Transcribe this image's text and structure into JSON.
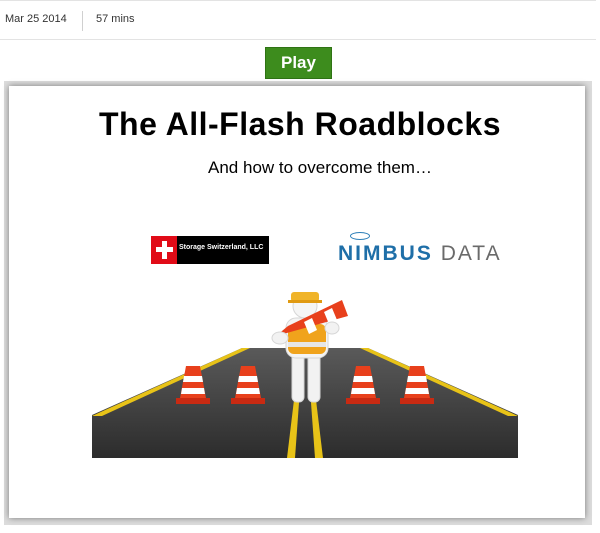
{
  "meta": {
    "date": "Mar 25 2014",
    "duration": "57 mins"
  },
  "play_label": "Play",
  "slide": {
    "title": "The All-Flash Roadblocks",
    "subtitle": "And how to overcome them…",
    "logo_left_text": "Storage Switzerland, LLC",
    "logo_right_part1": "NIMBUS",
    "logo_right_part2": "DATA"
  },
  "colors": {
    "play_green": "#3d8c1d",
    "road": "#3c3c3c",
    "cone_orange": "#e8401c",
    "lane_yellow": "#e8c318"
  }
}
